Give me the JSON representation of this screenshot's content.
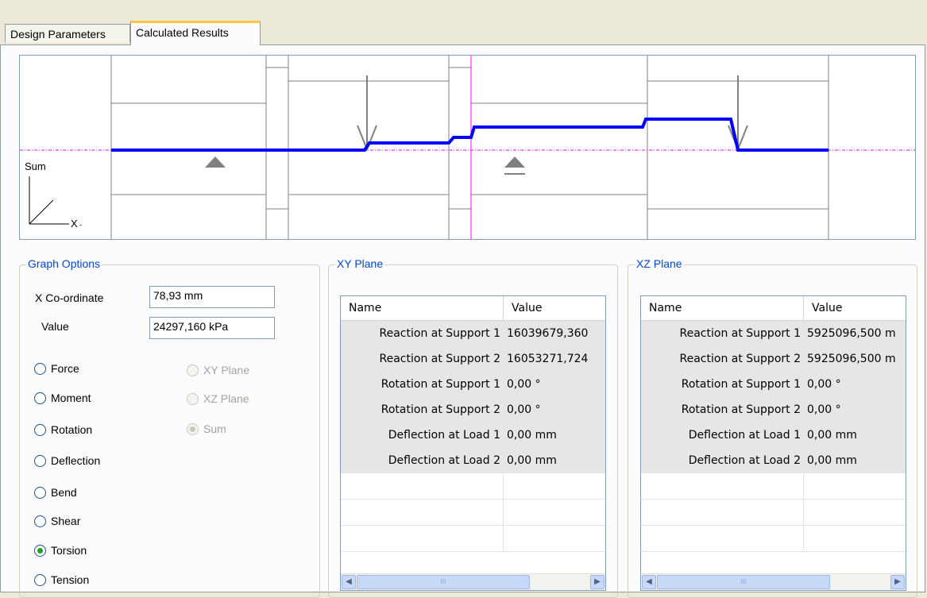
{
  "tabs": [
    {
      "label": "Design Parameters",
      "active": false
    },
    {
      "label": "Calculated Results",
      "active": true
    }
  ],
  "graph": {
    "axis_label": "Sum",
    "x_axis_label": "X",
    "curve_color": "#0000FF",
    "cursor_color": "#FF00FF"
  },
  "graph_options": {
    "title": "Graph Options",
    "x_coordinate_label": "X Co-ordinate",
    "x_coordinate_value": "78,93 mm",
    "value_label": "Value",
    "value_value": "24297,160 kPa",
    "quantity_options": [
      {
        "label": "Force",
        "selected": false
      },
      {
        "label": "Moment",
        "selected": false
      },
      {
        "label": "Rotation",
        "selected": false
      },
      {
        "label": "Deflection",
        "selected": false
      },
      {
        "label": "Bend",
        "selected": false
      },
      {
        "label": "Shear",
        "selected": false
      },
      {
        "label": "Torsion",
        "selected": true
      },
      {
        "label": "Tension",
        "selected": false
      }
    ],
    "plane_options": [
      {
        "label": "XY Plane",
        "selected": false,
        "enabled": false
      },
      {
        "label": "XZ Plane",
        "selected": false,
        "enabled": false
      },
      {
        "label": "Sum",
        "selected": true,
        "enabled": false
      }
    ]
  },
  "xy_plane": {
    "title": "XY Plane",
    "columns": [
      "Name",
      "Value"
    ],
    "rows": [
      {
        "name": "Reaction at Support 1",
        "value": "16039679,360"
      },
      {
        "name": "Reaction at Support 2",
        "value": "16053271,724"
      },
      {
        "name": "Rotation at Support 1",
        "value": "0,00 °"
      },
      {
        "name": "Rotation at Support 2",
        "value": "0,00 °"
      },
      {
        "name": "Deflection at Load 1",
        "value": "0,00 mm"
      },
      {
        "name": "Deflection at Load 2",
        "value": "0,00 mm"
      }
    ],
    "scroll_grip": "III"
  },
  "xz_plane": {
    "title": "XZ Plane",
    "columns": [
      "Name",
      "Value"
    ],
    "rows": [
      {
        "name": "Reaction at Support 1",
        "value": "5925096,500 m"
      },
      {
        "name": "Reaction at Support 2",
        "value": "5925096,500 m"
      },
      {
        "name": "Rotation at Support 1",
        "value": "0,00 °"
      },
      {
        "name": "Rotation at Support 2",
        "value": "0,00 °"
      },
      {
        "name": "Deflection at Load 1",
        "value": "0,00 mm"
      },
      {
        "name": "Deflection at Load 2",
        "value": "0,00 mm"
      }
    ],
    "scroll_grip": "III"
  }
}
